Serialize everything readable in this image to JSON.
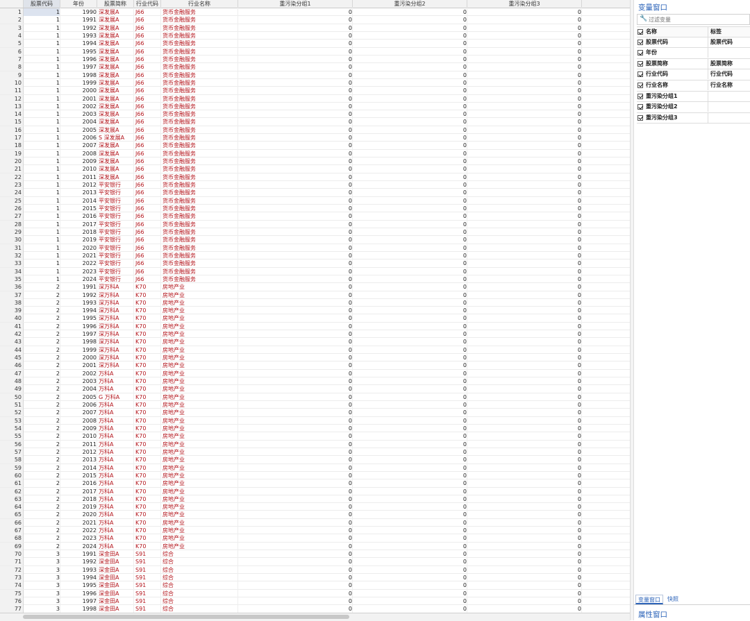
{
  "columns": [
    "股票代码",
    "年份",
    "股票简称",
    "行业代码",
    "行业名称",
    "重污染分组1",
    "重污染分组2",
    "重污染分组3"
  ],
  "rows": [
    [
      "1",
      "1",
      "1990",
      "深发展A",
      "J66",
      "货币金融服务",
      "0",
      "0",
      "0"
    ],
    [
      "2",
      "1",
      "1991",
      "深发展A",
      "J66",
      "货币金融服务",
      "0",
      "0",
      "0"
    ],
    [
      "3",
      "1",
      "1992",
      "深发展A",
      "J66",
      "货币金融服务",
      "0",
      "0",
      "0"
    ],
    [
      "4",
      "1",
      "1993",
      "深发展A",
      "J66",
      "货币金融服务",
      "0",
      "0",
      "0"
    ],
    [
      "5",
      "1",
      "1994",
      "深发展A",
      "J66",
      "货币金融服务",
      "0",
      "0",
      "0"
    ],
    [
      "6",
      "1",
      "1995",
      "深发展A",
      "J66",
      "货币金融服务",
      "0",
      "0",
      "0"
    ],
    [
      "7",
      "1",
      "1996",
      "深发展A",
      "J66",
      "货币金融服务",
      "0",
      "0",
      "0"
    ],
    [
      "8",
      "1",
      "1997",
      "深发展A",
      "J66",
      "货币金融服务",
      "0",
      "0",
      "0"
    ],
    [
      "9",
      "1",
      "1998",
      "深发展A",
      "J66",
      "货币金融服务",
      "0",
      "0",
      "0"
    ],
    [
      "10",
      "1",
      "1999",
      "深发展A",
      "J66",
      "货币金融服务",
      "0",
      "0",
      "0"
    ],
    [
      "11",
      "1",
      "2000",
      "深发展A",
      "J66",
      "货币金融服务",
      "0",
      "0",
      "0"
    ],
    [
      "12",
      "1",
      "2001",
      "深发展A",
      "J66",
      "货币金融服务",
      "0",
      "0",
      "0"
    ],
    [
      "13",
      "1",
      "2002",
      "深发展A",
      "J66",
      "货币金融服务",
      "0",
      "0",
      "0"
    ],
    [
      "14",
      "1",
      "2003",
      "深发展A",
      "J66",
      "货币金融服务",
      "0",
      "0",
      "0"
    ],
    [
      "15",
      "1",
      "2004",
      "深发展A",
      "J66",
      "货币金融服务",
      "0",
      "0",
      "0"
    ],
    [
      "16",
      "1",
      "2005",
      "深发展A",
      "J66",
      "货币金融服务",
      "0",
      "0",
      "0"
    ],
    [
      "17",
      "1",
      "2006",
      "S 深发展A",
      "J66",
      "货币金融服务",
      "0",
      "0",
      "0"
    ],
    [
      "18",
      "1",
      "2007",
      "深发展A",
      "J66",
      "货币金融服务",
      "0",
      "0",
      "0"
    ],
    [
      "19",
      "1",
      "2008",
      "深发展A",
      "J66",
      "货币金融服务",
      "0",
      "0",
      "0"
    ],
    [
      "20",
      "1",
      "2009",
      "深发展A",
      "J66",
      "货币金融服务",
      "0",
      "0",
      "0"
    ],
    [
      "21",
      "1",
      "2010",
      "深发展A",
      "J66",
      "货币金融服务",
      "0",
      "0",
      "0"
    ],
    [
      "22",
      "1",
      "2011",
      "深发展A",
      "J66",
      "货币金融服务",
      "0",
      "0",
      "0"
    ],
    [
      "23",
      "1",
      "2012",
      "平安银行",
      "J66",
      "货币金融服务",
      "0",
      "0",
      "0"
    ],
    [
      "24",
      "1",
      "2013",
      "平安银行",
      "J66",
      "货币金融服务",
      "0",
      "0",
      "0"
    ],
    [
      "25",
      "1",
      "2014",
      "平安银行",
      "J66",
      "货币金融服务",
      "0",
      "0",
      "0"
    ],
    [
      "26",
      "1",
      "2015",
      "平安银行",
      "J66",
      "货币金融服务",
      "0",
      "0",
      "0"
    ],
    [
      "27",
      "1",
      "2016",
      "平安银行",
      "J66",
      "货币金融服务",
      "0",
      "0",
      "0"
    ],
    [
      "28",
      "1",
      "2017",
      "平安银行",
      "J66",
      "货币金融服务",
      "0",
      "0",
      "0"
    ],
    [
      "29",
      "1",
      "2018",
      "平安银行",
      "J66",
      "货币金融服务",
      "0",
      "0",
      "0"
    ],
    [
      "30",
      "1",
      "2019",
      "平安银行",
      "J66",
      "货币金融服务",
      "0",
      "0",
      "0"
    ],
    [
      "31",
      "1",
      "2020",
      "平安银行",
      "J66",
      "货币金融服务",
      "0",
      "0",
      "0"
    ],
    [
      "32",
      "1",
      "2021",
      "平安银行",
      "J66",
      "货币金融服务",
      "0",
      "0",
      "0"
    ],
    [
      "33",
      "1",
      "2022",
      "平安银行",
      "J66",
      "货币金融服务",
      "0",
      "0",
      "0"
    ],
    [
      "34",
      "1",
      "2023",
      "平安银行",
      "J66",
      "货币金融服务",
      "0",
      "0",
      "0"
    ],
    [
      "35",
      "1",
      "2024",
      "平安银行",
      "J66",
      "货币金融服务",
      "0",
      "0",
      "0"
    ],
    [
      "36",
      "2",
      "1991",
      "深万科A",
      "K70",
      "房地产业",
      "0",
      "0",
      "0"
    ],
    [
      "37",
      "2",
      "1992",
      "深万科A",
      "K70",
      "房地产业",
      "0",
      "0",
      "0"
    ],
    [
      "38",
      "2",
      "1993",
      "深万科A",
      "K70",
      "房地产业",
      "0",
      "0",
      "0"
    ],
    [
      "39",
      "2",
      "1994",
      "深万科A",
      "K70",
      "房地产业",
      "0",
      "0",
      "0"
    ],
    [
      "40",
      "2",
      "1995",
      "深万科A",
      "K70",
      "房地产业",
      "0",
      "0",
      "0"
    ],
    [
      "41",
      "2",
      "1996",
      "深万科A",
      "K70",
      "房地产业",
      "0",
      "0",
      "0"
    ],
    [
      "42",
      "2",
      "1997",
      "深万科A",
      "K70",
      "房地产业",
      "0",
      "0",
      "0"
    ],
    [
      "43",
      "2",
      "1998",
      "深万科A",
      "K70",
      "房地产业",
      "0",
      "0",
      "0"
    ],
    [
      "44",
      "2",
      "1999",
      "深万科A",
      "K70",
      "房地产业",
      "0",
      "0",
      "0"
    ],
    [
      "45",
      "2",
      "2000",
      "深万科A",
      "K70",
      "房地产业",
      "0",
      "0",
      "0"
    ],
    [
      "46",
      "2",
      "2001",
      "深万科A",
      "K70",
      "房地产业",
      "0",
      "0",
      "0"
    ],
    [
      "47",
      "2",
      "2002",
      "万科A",
      "K70",
      "房地产业",
      "0",
      "0",
      "0"
    ],
    [
      "48",
      "2",
      "2003",
      "万科A",
      "K70",
      "房地产业",
      "0",
      "0",
      "0"
    ],
    [
      "49",
      "2",
      "2004",
      "万科A",
      "K70",
      "房地产业",
      "0",
      "0",
      "0"
    ],
    [
      "50",
      "2",
      "2005",
      "G 万科A",
      "K70",
      "房地产业",
      "0",
      "0",
      "0"
    ],
    [
      "51",
      "2",
      "2006",
      "万科A",
      "K70",
      "房地产业",
      "0",
      "0",
      "0"
    ],
    [
      "52",
      "2",
      "2007",
      "万科A",
      "K70",
      "房地产业",
      "0",
      "0",
      "0"
    ],
    [
      "53",
      "2",
      "2008",
      "万科A",
      "K70",
      "房地产业",
      "0",
      "0",
      "0"
    ],
    [
      "54",
      "2",
      "2009",
      "万科A",
      "K70",
      "房地产业",
      "0",
      "0",
      "0"
    ],
    [
      "55",
      "2",
      "2010",
      "万科A",
      "K70",
      "房地产业",
      "0",
      "0",
      "0"
    ],
    [
      "56",
      "2",
      "2011",
      "万科A",
      "K70",
      "房地产业",
      "0",
      "0",
      "0"
    ],
    [
      "57",
      "2",
      "2012",
      "万科A",
      "K70",
      "房地产业",
      "0",
      "0",
      "0"
    ],
    [
      "58",
      "2",
      "2013",
      "万科A",
      "K70",
      "房地产业",
      "0",
      "0",
      "0"
    ],
    [
      "59",
      "2",
      "2014",
      "万科A",
      "K70",
      "房地产业",
      "0",
      "0",
      "0"
    ],
    [
      "60",
      "2",
      "2015",
      "万科A",
      "K70",
      "房地产业",
      "0",
      "0",
      "0"
    ],
    [
      "61",
      "2",
      "2016",
      "万科A",
      "K70",
      "房地产业",
      "0",
      "0",
      "0"
    ],
    [
      "62",
      "2",
      "2017",
      "万科A",
      "K70",
      "房地产业",
      "0",
      "0",
      "0"
    ],
    [
      "63",
      "2",
      "2018",
      "万科A",
      "K70",
      "房地产业",
      "0",
      "0",
      "0"
    ],
    [
      "64",
      "2",
      "2019",
      "万科A",
      "K70",
      "房地产业",
      "0",
      "0",
      "0"
    ],
    [
      "65",
      "2",
      "2020",
      "万科A",
      "K70",
      "房地产业",
      "0",
      "0",
      "0"
    ],
    [
      "66",
      "2",
      "2021",
      "万科A",
      "K70",
      "房地产业",
      "0",
      "0",
      "0"
    ],
    [
      "67",
      "2",
      "2022",
      "万科A",
      "K70",
      "房地产业",
      "0",
      "0",
      "0"
    ],
    [
      "68",
      "2",
      "2023",
      "万科A",
      "K70",
      "房地产业",
      "0",
      "0",
      "0"
    ],
    [
      "69",
      "2",
      "2024",
      "万科A",
      "K70",
      "房地产业",
      "0",
      "0",
      "0"
    ],
    [
      "70",
      "3",
      "1991",
      "深金田A",
      "S91",
      "综合",
      "0",
      "0",
      "0"
    ],
    [
      "71",
      "3",
      "1992",
      "深金田A",
      "S91",
      "综合",
      "0",
      "0",
      "0"
    ],
    [
      "72",
      "3",
      "1993",
      "深金田A",
      "S91",
      "综合",
      "0",
      "0",
      "0"
    ],
    [
      "73",
      "3",
      "1994",
      "深金田A",
      "S91",
      "综合",
      "0",
      "0",
      "0"
    ],
    [
      "74",
      "3",
      "1995",
      "深金田A",
      "S91",
      "综合",
      "0",
      "0",
      "0"
    ],
    [
      "75",
      "3",
      "1996",
      "深金田A",
      "S91",
      "综合",
      "0",
      "0",
      "0"
    ],
    [
      "76",
      "3",
      "1997",
      "深金田A",
      "S91",
      "综合",
      "0",
      "0",
      "0"
    ],
    [
      "77",
      "3",
      "1998",
      "深金田A",
      "S91",
      "综合",
      "0",
      "0",
      "0"
    ]
  ],
  "variables_panel": {
    "title": "变量窗口",
    "filter_placeholder": "过滤变量",
    "header_name": "名称",
    "header_label": "标签",
    "variables": [
      {
        "name": "股票代码",
        "label": "股票代码"
      },
      {
        "name": "年份",
        "label": ""
      },
      {
        "name": "股票简称",
        "label": "股票简称"
      },
      {
        "name": "行业代码",
        "label": "行业代码"
      },
      {
        "name": "行业名称",
        "label": "行业名称"
      },
      {
        "name": "重污染分组1",
        "label": ""
      },
      {
        "name": "重污染分组2",
        "label": ""
      },
      {
        "name": "重污染分组3",
        "label": ""
      }
    ],
    "tabs": [
      "变量窗口",
      "快照"
    ]
  },
  "properties_panel": {
    "title": "属性窗口"
  },
  "colors": {
    "string_text": "#b3141b",
    "accent": "#2a62b8"
  }
}
